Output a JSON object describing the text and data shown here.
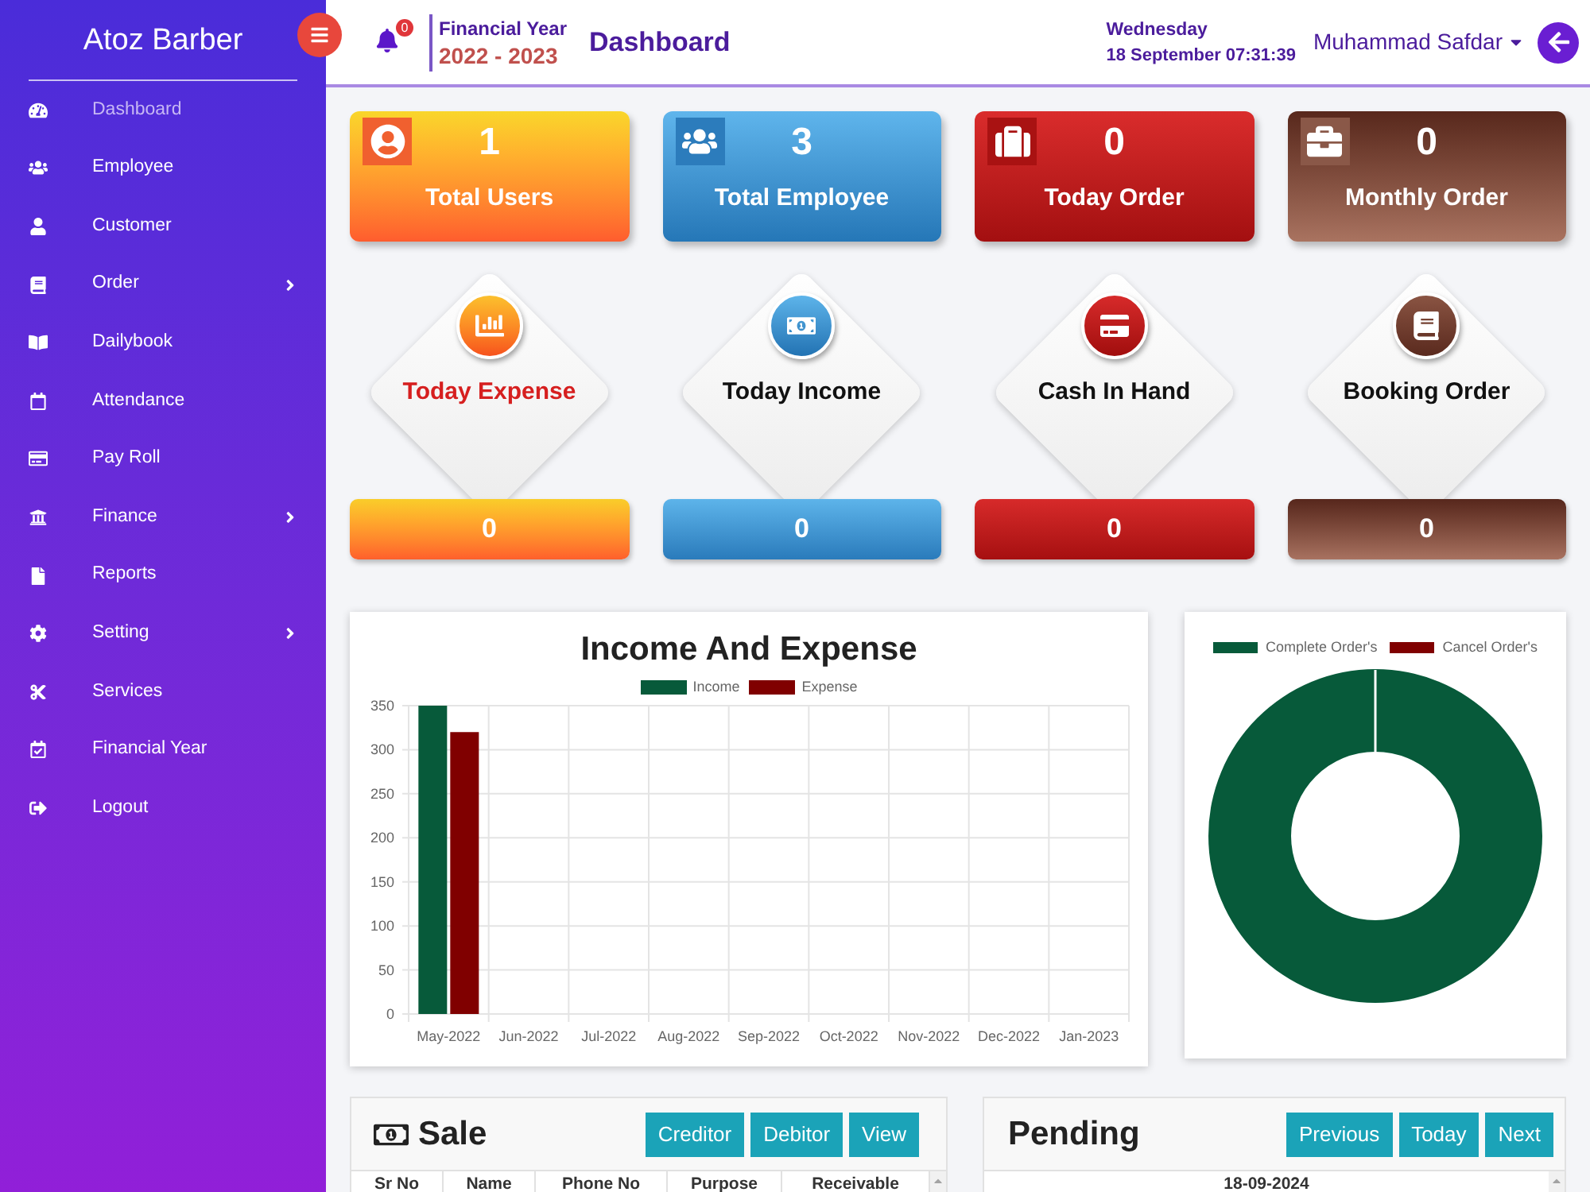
{
  "sidebar": {
    "brand": "Atoz Barber",
    "items": [
      {
        "label": "Dashboard",
        "selected": true,
        "submenu": false
      },
      {
        "label": "Employee",
        "selected": false,
        "submenu": false
      },
      {
        "label": "Customer",
        "selected": false,
        "submenu": false
      },
      {
        "label": "Order",
        "selected": false,
        "submenu": true
      },
      {
        "label": "Dailybook",
        "selected": false,
        "submenu": false
      },
      {
        "label": "Attendance",
        "selected": false,
        "submenu": false
      },
      {
        "label": "Pay Roll",
        "selected": false,
        "submenu": false
      },
      {
        "label": "Finance",
        "selected": false,
        "submenu": true
      },
      {
        "label": "Reports",
        "selected": false,
        "submenu": false
      },
      {
        "label": "Setting",
        "selected": false,
        "submenu": true
      },
      {
        "label": "Services",
        "selected": false,
        "submenu": false
      },
      {
        "label": "Financial Year",
        "selected": false,
        "submenu": false
      },
      {
        "label": "Logout",
        "selected": false,
        "submenu": false
      }
    ]
  },
  "header": {
    "notification_count": "0",
    "financial_year": {
      "label": "Financial Year",
      "value": "2022 - 2023"
    },
    "page_title": "Dashboard",
    "day": "Wednesday",
    "datetime": "18 September 07:31:39",
    "user_name": "Muhammad Safdar"
  },
  "stat_cards": [
    {
      "value": "1",
      "label": "Total Users"
    },
    {
      "value": "3",
      "label": "Total Employee"
    },
    {
      "value": "0",
      "label": "Today Order"
    },
    {
      "value": "0",
      "label": "Monthly Order"
    }
  ],
  "summary_tiles": [
    {
      "label": "Today Expense",
      "value": "0",
      "highlighted": true
    },
    {
      "label": "Today Income",
      "value": "0",
      "highlighted": false
    },
    {
      "label": "Cash In Hand",
      "value": "0",
      "highlighted": false
    },
    {
      "label": "Booking Order",
      "value": "0",
      "highlighted": false
    }
  ],
  "income_expense_chart": {
    "chart_data": {
      "type": "bar",
      "title": "Income And Expense",
      "categories": [
        "May-2022",
        "Jun-2022",
        "Jul-2022",
        "Aug-2022",
        "Sep-2022",
        "Oct-2022",
        "Nov-2022",
        "Dec-2022",
        "Jan-2023"
      ],
      "series": [
        {
          "name": "Income",
          "color": "#075a3a",
          "values": [
            350,
            0,
            0,
            0,
            0,
            0,
            0,
            0,
            0
          ]
        },
        {
          "name": "Expense",
          "color": "#800000",
          "values": [
            320,
            0,
            0,
            0,
            0,
            0,
            0,
            0,
            0
          ]
        }
      ],
      "ylim": [
        0,
        350
      ],
      "yticks": [
        0,
        50,
        100,
        150,
        200,
        250,
        300,
        350
      ],
      "grid": true
    }
  },
  "orders_chart": {
    "legend": [
      {
        "label": "Complete Order's",
        "color": "#075a3a"
      },
      {
        "label": "Cancel Order's",
        "color": "#800000"
      }
    ]
  },
  "sale_panel": {
    "title": "Sale",
    "buttons": [
      "Creditor",
      "Debitor",
      "View"
    ],
    "columns": [
      "Sr No",
      "Name",
      "Phone No",
      "Purpose",
      "Receivable"
    ]
  },
  "pending_panel": {
    "title": "Pending",
    "buttons": [
      "Previous",
      "Today",
      "Next"
    ],
    "date": "18-09-2024"
  }
}
